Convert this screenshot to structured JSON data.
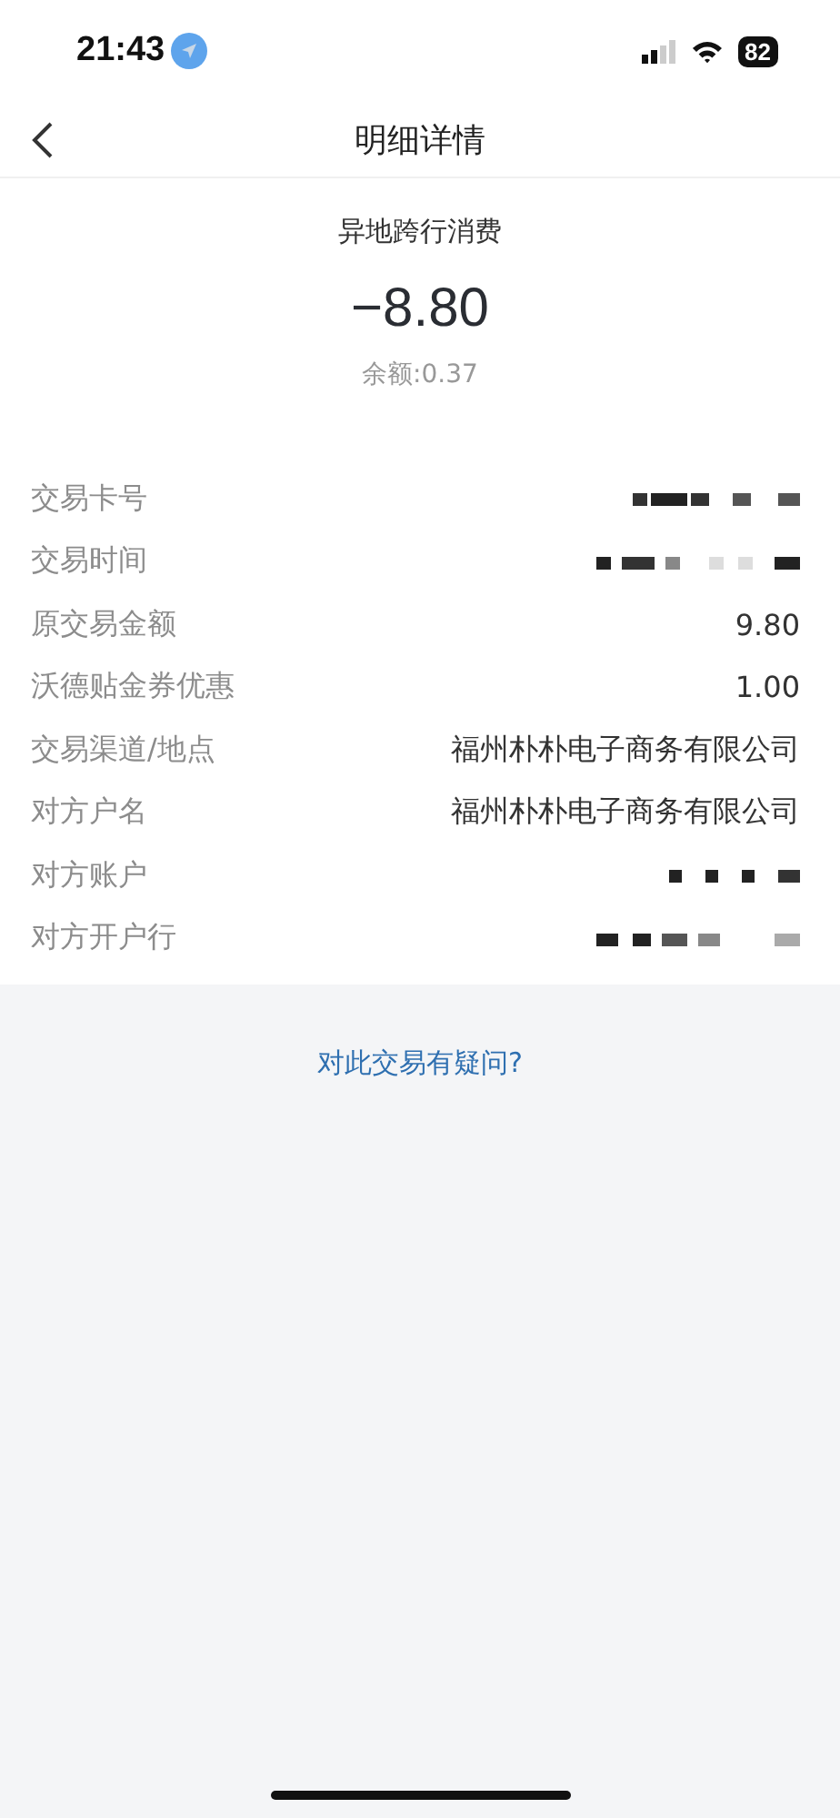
{
  "status_bar": {
    "time": "21:43",
    "battery": "82"
  },
  "nav_bar": {
    "title": "明细详情"
  },
  "summary": {
    "description": "异地跨行消费",
    "amount": "−8.80",
    "balance": "余额:0.37"
  },
  "details": [
    {
      "kind": "masked",
      "label": "交易卡号"
    },
    {
      "kind": "masked",
      "label": "交易时间"
    },
    {
      "kind": "text",
      "label": "原交易金额",
      "value": "9.80"
    },
    {
      "kind": "text",
      "label": "沃德贴金券优惠",
      "value": "1.00"
    },
    {
      "kind": "text",
      "label": "交易渠道/地点",
      "value": "福州朴朴电子商务有限公司"
    },
    {
      "kind": "text",
      "label": "对方户名",
      "value": "福州朴朴电子商务有限公司"
    },
    {
      "kind": "masked",
      "label": "对方账户"
    },
    {
      "kind": "masked",
      "label": "对方开户行"
    }
  ],
  "help_link": "对此交易有疑问?"
}
